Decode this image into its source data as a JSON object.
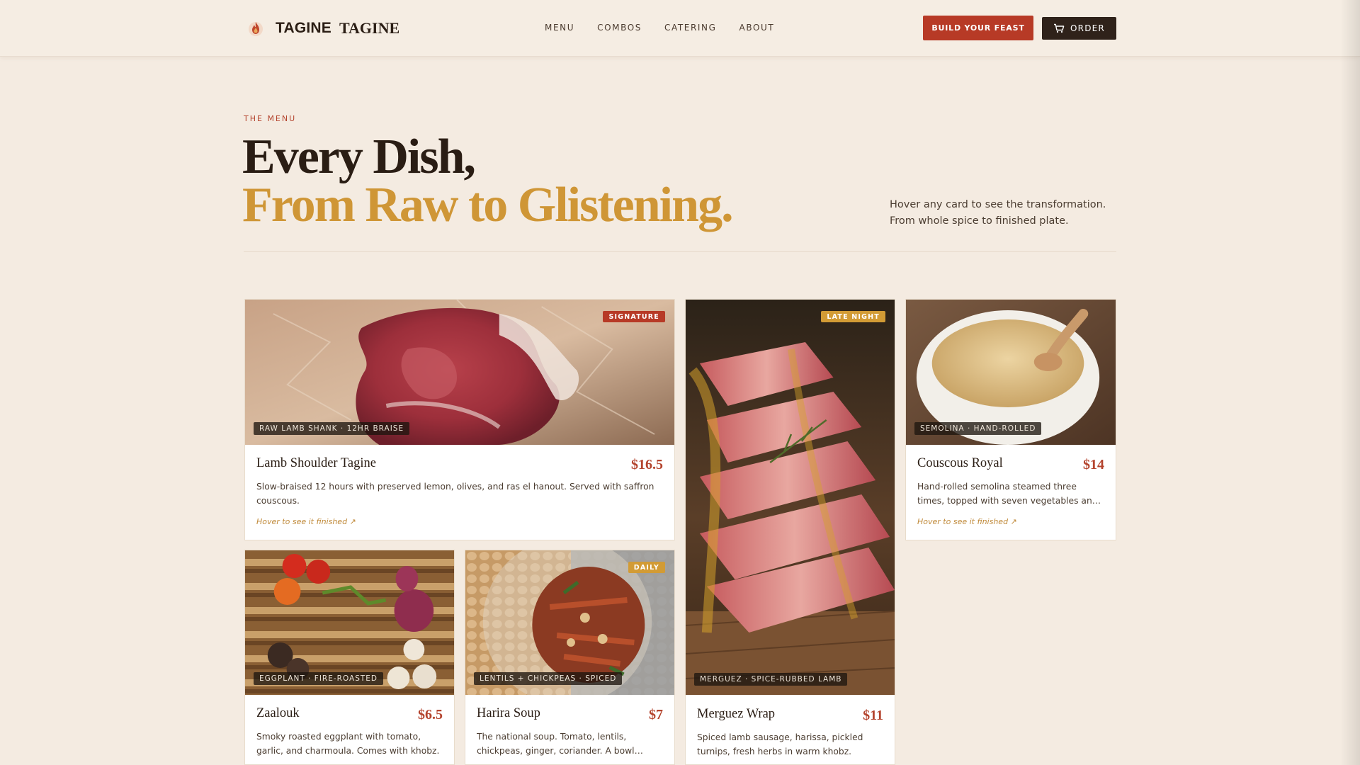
{
  "brand": {
    "word1": "TAGINE",
    "word2": "TAGINE"
  },
  "nav": [
    "MENU",
    "COMBOS",
    "CATERING",
    "ABOUT"
  ],
  "actions": {
    "feast": "BUILD YOUR FEAST",
    "order": "ORDER"
  },
  "hero": {
    "eyebrow": "THE MENU",
    "line1": "Every Dish,",
    "line2": "From Raw to Glistening.",
    "note": "Hover any card to see the transformation. From whole spice to finished plate."
  },
  "colors": {
    "accent_red": "#b73a26",
    "accent_gold": "#cf9636",
    "dark": "#2f221a",
    "bg": "#f4ebe1"
  },
  "cards": [
    {
      "tag": "SIGNATURE",
      "caption": "RAW LAMB SHANK · 12HR BRAISE",
      "title": "Lamb Shoulder Tagine",
      "price": "$16.5",
      "desc": "Slow-braised 12 hours with preserved lemon, olives, and ras el hanout. Served with saffron couscous.",
      "hover": "Hover to see it finished ↗"
    },
    {
      "tag": "LATE NIGHT",
      "caption": "MERGUEZ · SPICE-RUBBED LAMB",
      "title": "Merguez Wrap",
      "price": "$11",
      "desc": "Spiced lamb sausage, harissa, pickled turnips, fresh herbs in warm khobz."
    },
    {
      "caption": "SEMOLINA · HAND-ROLLED",
      "title": "Couscous Royal",
      "price": "$14",
      "desc": "Hand-rolled semolina steamed three times, topped with seven vegetables and chicken.",
      "hover": "Hover to see it finished ↗"
    },
    {
      "caption": "EGGPLANT · FIRE-ROASTED",
      "title": "Zaalouk",
      "price": "$6.5",
      "desc": "Smoky roasted eggplant with tomato, garlic, and charmoula. Comes with khobz."
    },
    {
      "tag": "DAILY",
      "caption": "LENTILS + CHICKPEAS · SPICED",
      "title": "Harira Soup",
      "price": "$7",
      "desc": "The national soup. Tomato, lentils, chickpeas, ginger, coriander. A bowl that..."
    }
  ]
}
